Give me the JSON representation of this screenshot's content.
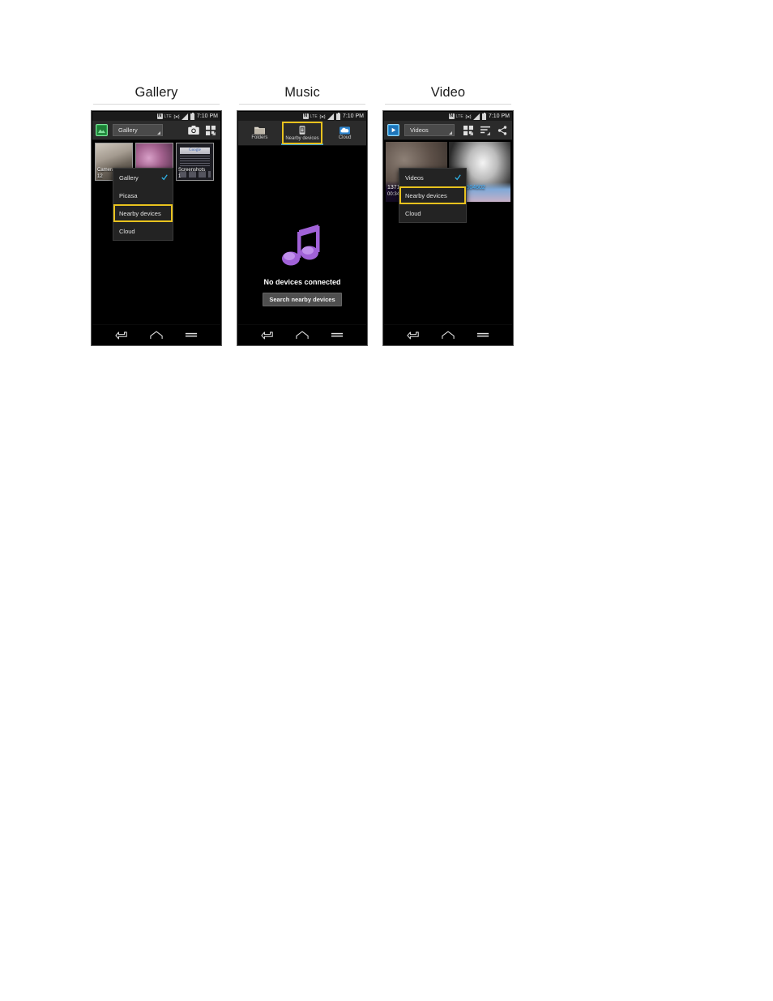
{
  "page": {
    "background": "#ffffff"
  },
  "colors": {
    "highlight": "#e8c21e",
    "accent_blue": "#3b9dd0",
    "check_blue": "#2fb3e8",
    "music_note": "#a162d8",
    "gallery_icon": "#2aa84a",
    "video_icon": "#2f9de0",
    "cloud_icon": "#2f86d0"
  },
  "columns": [
    {
      "caption": "Gallery",
      "status_bar": {
        "nfc": "N",
        "nfc_icon": "nfc-icon",
        "network": "LTE",
        "sync_icon": "sync-icon",
        "signal_icon": "signal-bars-icon",
        "battery_icon": "battery-icon",
        "time": "7:10 PM"
      },
      "action_bar": {
        "app_icon": "gallery-app-icon",
        "spinner_label": "Gallery",
        "caret_icon": "dropdown-caret-icon",
        "icons": [
          {
            "name": "camera-icon"
          },
          {
            "name": "grid-view-icon"
          }
        ]
      },
      "albums": [
        {
          "name": "Camera",
          "count": "12",
          "thumb": "camera-thumb"
        },
        {
          "name": "",
          "count": "",
          "thumb": "flower-thumb"
        },
        {
          "name": "Screenshots",
          "count": "1",
          "thumb": "screenshot-thumb",
          "thumb_text": "Google"
        }
      ],
      "dropdown": {
        "items": [
          {
            "label": "Gallery",
            "checked": true,
            "highlighted": false
          },
          {
            "label": "Picasa",
            "checked": false,
            "highlighted": false
          },
          {
            "label": "Nearby devices",
            "checked": false,
            "highlighted": true
          },
          {
            "label": "Cloud",
            "checked": false,
            "highlighted": false
          }
        ]
      },
      "nav_bar": {
        "back": "back-icon",
        "home": "home-icon",
        "menu": "menu-icon"
      }
    },
    {
      "caption": "Music",
      "status_bar": {
        "nfc": "N",
        "nfc_icon": "nfc-icon",
        "network": "LTE",
        "sync_icon": "sync-icon",
        "signal_icon": "signal-bars-icon",
        "battery_icon": "battery-icon",
        "time": "7:10 PM"
      },
      "tabs": [
        {
          "label": "Folders",
          "icon": "folder-icon",
          "selected": false,
          "highlighted": false
        },
        {
          "label": "Nearby devices",
          "icon": "nearby-devices-icon",
          "selected": true,
          "highlighted": true
        },
        {
          "label": "Cloud",
          "icon": "cloud-icon",
          "selected": false,
          "highlighted": false
        }
      ],
      "empty_state": {
        "icon": "music-note-icon",
        "message": "No devices connected",
        "button_label": "Search nearby devices"
      },
      "nav_bar": {
        "back": "back-icon",
        "home": "home-icon",
        "menu": "menu-icon"
      }
    },
    {
      "caption": "Video",
      "status_bar": {
        "nfc": "N",
        "nfc_icon": "nfc-icon",
        "network": "LTE",
        "sync_icon": "sync-icon",
        "signal_icon": "signal-bars-icon",
        "battery_icon": "battery-icon",
        "time": "7:10 PM"
      },
      "action_bar": {
        "app_icon": "video-app-icon",
        "spinner_label": "Videos",
        "caret_icon": "dropdown-caret-icon",
        "icons": [
          {
            "name": "grid-view-icon"
          },
          {
            "name": "sort-icon"
          },
          {
            "name": "share-icon"
          }
        ]
      },
      "videos": [
        {
          "label": "1371",
          "duration": "00:34",
          "thumb": "cat-thumb-1"
        },
        {
          "label": "20150504602",
          "duration": "",
          "thumb": "cat-thumb-2"
        }
      ],
      "dropdown": {
        "items": [
          {
            "label": "Videos",
            "checked": true,
            "highlighted": false
          },
          {
            "label": "Nearby devices",
            "checked": false,
            "highlighted": true
          },
          {
            "label": "Cloud",
            "checked": false,
            "highlighted": false
          }
        ]
      },
      "nav_bar": {
        "back": "back-icon",
        "home": "home-icon",
        "menu": "menu-icon"
      }
    }
  ]
}
